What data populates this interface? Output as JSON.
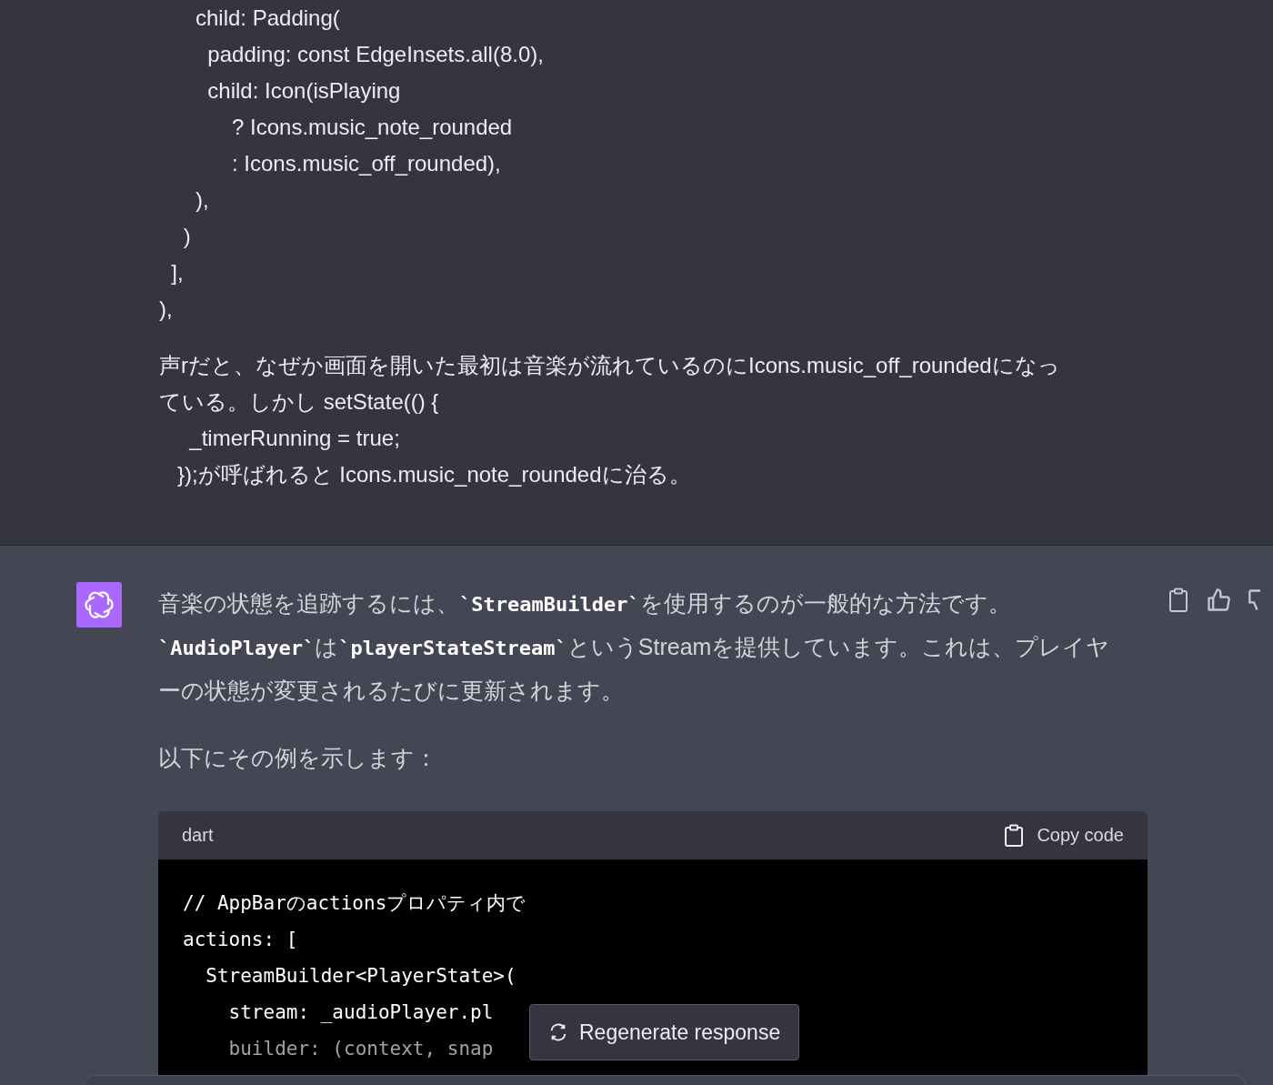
{
  "user_message": {
    "code_lines": [
      "      child: Padding(",
      "        padding: const EdgeInsets.all(8.0),",
      "        child: Icon(isPlaying",
      "            ? Icons.music_note_rounded",
      "            : Icons.music_off_rounded),",
      "      ),",
      "    )",
      "  ],",
      "),"
    ],
    "text_lines": [
      "声rだと、なぜか画面を開いた最初は音楽が流れているのにIcons.music_off_roundedになっ",
      "ている。しかし setState(() {",
      "     _timerRunning = true;",
      "   });が呼ばれると Icons.music_note_roundedに治る。"
    ]
  },
  "assistant_message": {
    "paragraphs": [
      "音楽の状態を追跡するには、**`StreamBuilder`**を使用するのが一般的な方法です。**`AudioPlayer`**は**`playerStateStream`**というStreamを提供しています。これは、プレイヤーの状態が変更されるたびに更新されます。",
      "以下にその例を示します："
    ],
    "code_block": {
      "language": "dart",
      "copy_label": "Copy code",
      "lines": [
        "// AppBarのactionsプロパティ内で",
        "actions: [",
        "  StreamBuilder<PlayerState>(",
        "    stream: _audioPlayer.pl",
        "    builder: (context, snap"
      ]
    }
  },
  "regenerate_button": "Regenerate response"
}
